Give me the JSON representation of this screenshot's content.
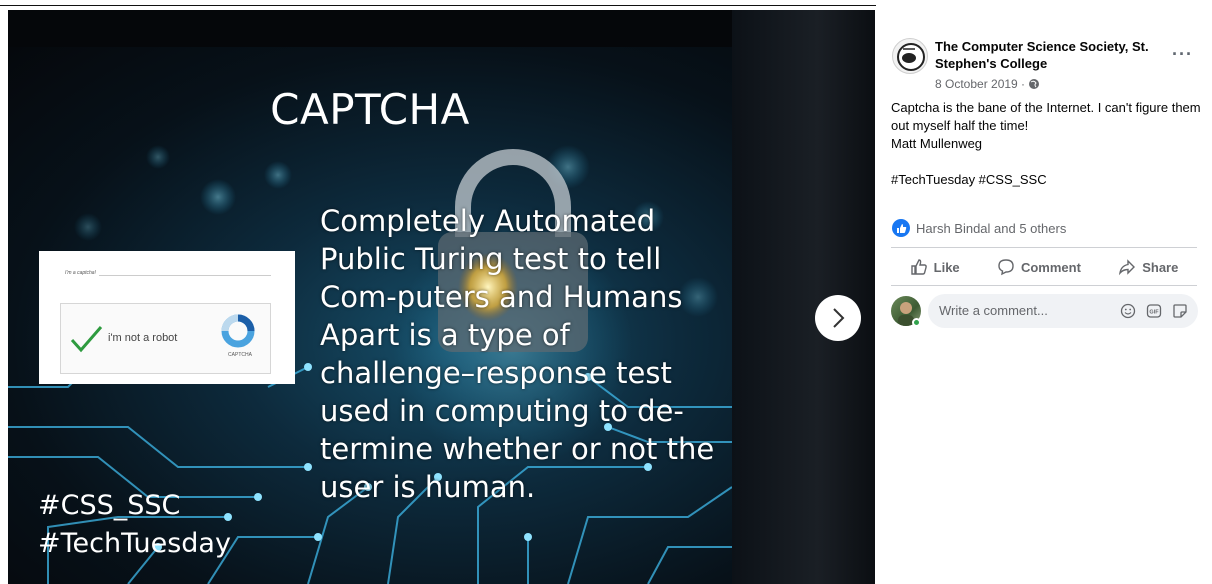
{
  "slide": {
    "title": "CAPTCHA",
    "body": "Completely Automated Public Turing test to tell Com-puters and Humans Apart is a type of challenge–response test used in computing to de-termine whether or not the user is human.",
    "tag1": "#CSS_SSC",
    "tag2": "#TechTuesday",
    "captcha": {
      "header": "I'm a captcha!",
      "checkbox_label": "i'm not a robot",
      "logo_text": "CAPTCHA"
    }
  },
  "post": {
    "page_name": "The Computer Science Society, St. Stephen's College",
    "date": "8 October 2019 ·",
    "text_line1": "Captcha is the bane of the Internet. I can't figure them out myself half the time!",
    "text_line2": "Matt Mullenweg",
    "hashtags": "#TechTuesday #CSS_SSC",
    "reactions": "Harsh Bindal and 5 others"
  },
  "actions": {
    "like": "Like",
    "comment": "Comment",
    "share": "Share"
  },
  "comment_box": {
    "placeholder": "Write a comment..."
  },
  "colors": {
    "accent": "#1877f2",
    "online": "#31a24c",
    "secondary_text": "#65676b"
  }
}
